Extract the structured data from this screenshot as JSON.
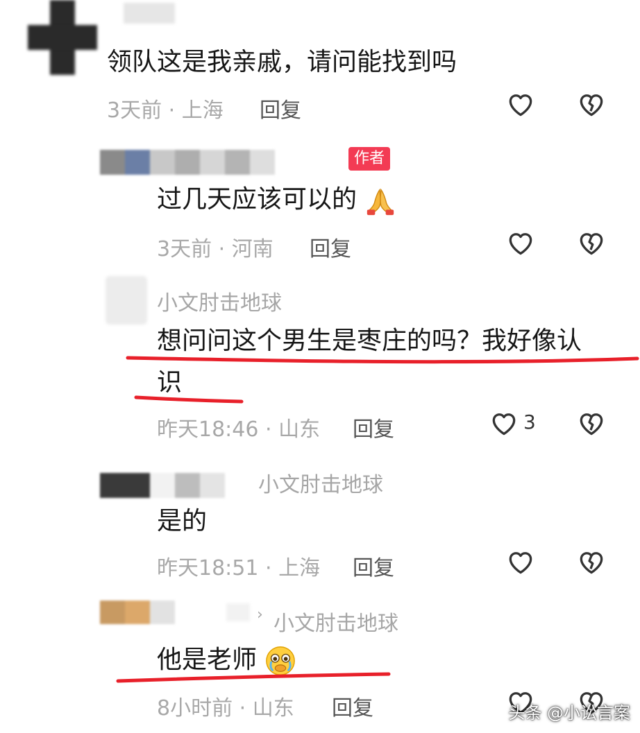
{
  "comments": [
    {
      "text": "领队这是我亲戚，请问能找到吗",
      "time": "3天前",
      "location": "上海",
      "reply_label": "回复",
      "likes": ""
    },
    {
      "badge": "作者",
      "text": "过几天应该可以的",
      "time": "3天前",
      "location": "河南",
      "reply_label": "回复",
      "likes": ""
    },
    {
      "username": "小文肘击地球",
      "text_line1": "想问问这个男生是枣庄的吗？我好像认",
      "text_line2": "识",
      "time": "昨天18:46",
      "location": "山东",
      "reply_label": "回复",
      "likes": "3"
    },
    {
      "reply_to": "小文肘击地球",
      "text": "是的",
      "time": "昨天18:51",
      "location": "上海",
      "reply_label": "回复",
      "likes": ""
    },
    {
      "reply_to": "小文肘击地球",
      "text": "他是老师",
      "time": "8小时前",
      "location": "山东",
      "reply_label": "回复",
      "likes": ""
    }
  ],
  "separator": "·",
  "reply_arrow": "›",
  "watermark": "头条 @小讼言案",
  "icons": {
    "like": "heart-outline-icon",
    "dislike": "broken-heart-icon",
    "folded_hands": "folded-hands-emoji",
    "crying_face": "crying-face-emoji"
  },
  "colors": {
    "underline": "#e8202a",
    "author_badge": "#f33b54",
    "meta_text": "#a8a8a8"
  }
}
